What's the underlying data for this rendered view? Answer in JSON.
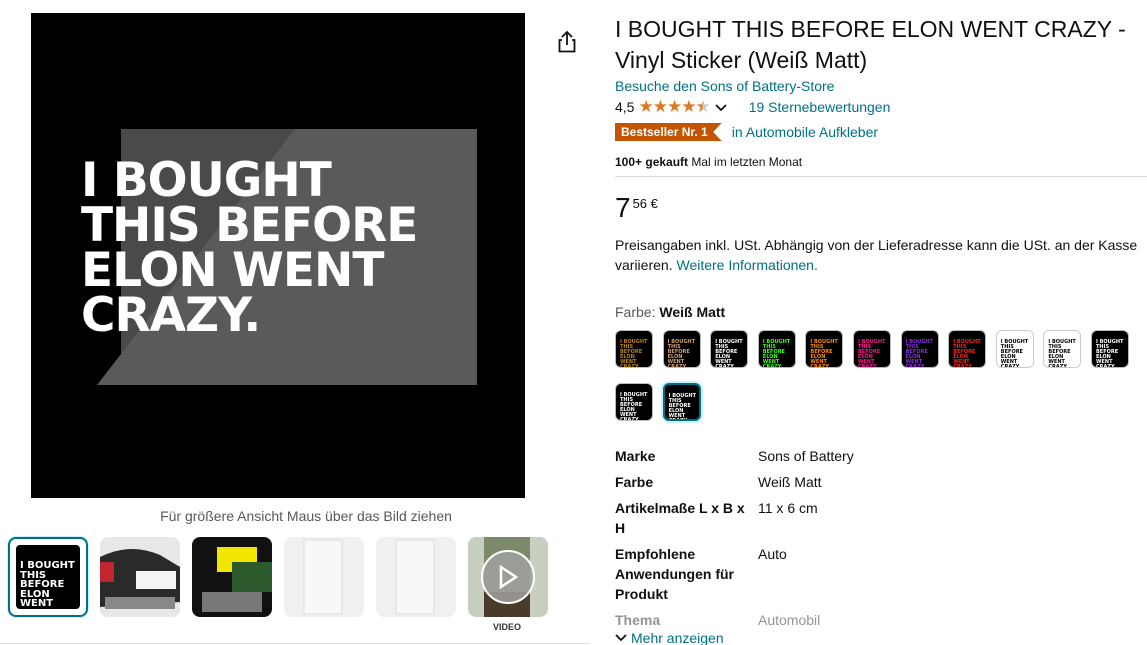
{
  "main_image": {
    "sticker_text": "I BOUGHT\nTHIS BEFORE\nELON WENT\nCRAZY."
  },
  "share": {
    "icon": "share-icon"
  },
  "zoom_hint": "Für größere Ansicht Maus über das Bild ziehen",
  "thumbnails": {
    "first_text": "I BOUGHT\nTHIS BEFORE\nELON WENT\nCRAZY.",
    "video_label": "VIDEO"
  },
  "product": {
    "title": "I BOUGHT THIS BEFORE ELON WENT CRAZY - Vinyl Sticker (Weiß Matt)",
    "store_link": "Besuche den Sons of Battery-Store",
    "rating_value": "4,5",
    "rating_count": "19 Sternebewertungen",
    "badge": "Bestseller Nr. 1",
    "badge_category": "in Automobile Aufkleber",
    "bought_bold": "100+ gekauft",
    "bought_rest": " Mal im letzten Monat",
    "price_whole": "7",
    "price_fraction": "56 €",
    "price_note": "Preisangaben inkl. USt. Abhängig von der Lieferadresse kann die USt. an der Kasse variieren.",
    "price_note_link": "Weitere Informationen.",
    "color_label": "Farbe:",
    "color_value": "Weiß Matt"
  },
  "swatches": {
    "label": "I BOUGHT\nTHIS BEFORE\nELON WENT\nCRAZY.",
    "colors": [
      "#b8860b",
      "#d2a070",
      "#ffffff",
      "#39ff14",
      "#ff8c00",
      "#ff1493",
      "#8a2be2",
      "#ff2020",
      "#000000",
      "#000000",
      "#ffffff",
      "#ffffff",
      "#ffffff"
    ],
    "selected_index": 12
  },
  "specs": [
    {
      "key": "Marke",
      "value": "Sons of Battery"
    },
    {
      "key": "Farbe",
      "value": "Weiß Matt"
    },
    {
      "key": "Artikelmaße L x B x H",
      "value": "11 x 6 cm"
    },
    {
      "key": "Empfohlene Anwendungen für Produkt",
      "value": "Auto"
    },
    {
      "key": "Thema",
      "value": "Automobil"
    }
  ],
  "more_link": "Mehr anzeigen",
  "colors": {
    "link": "#007185",
    "star": "#de7921",
    "badge": "#c45500"
  }
}
